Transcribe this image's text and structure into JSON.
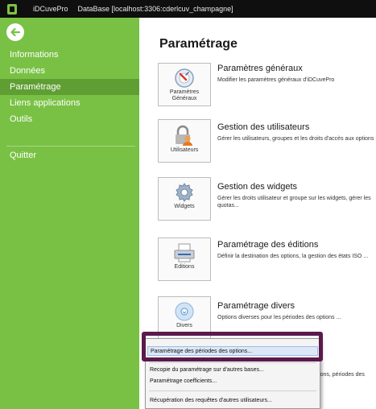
{
  "titlebar": {
    "app_name": "iDCuvePro",
    "db_info": "DataBase [localhost:3306:cderlcuv_champagne]"
  },
  "sidebar": {
    "items": [
      {
        "label": "Informations",
        "active": false
      },
      {
        "label": "Données",
        "active": false
      },
      {
        "label": "Paramétrage",
        "active": true
      },
      {
        "label": "Liens applications",
        "active": false
      },
      {
        "label": "Outils",
        "active": false
      }
    ],
    "quit_label": "Quitter"
  },
  "main": {
    "title": "Paramétrage",
    "sections": [
      {
        "tile_label": "Paramètres Généraux",
        "title": "Paramètres généraux",
        "desc": "Modifier les paramètres généraux d'iDCuvePro",
        "icon": "settings-gauge-icon"
      },
      {
        "tile_label": "Utilisateurs",
        "title": "Gestion des utilisateurs",
        "desc": "Gérer les utilisateurs, groupes et les droits d'accès aux options",
        "icon": "users-lock-icon"
      },
      {
        "tile_label": "Widgets",
        "title": "Gestion des widgets",
        "desc": "Gérer les droits utilisateur et groupe sur les widgets, gérer les quotas...",
        "icon": "widget-gear-icon"
      },
      {
        "tile_label": "Editions",
        "title": "Paramétrage des éditions",
        "desc": "Définir la destination des options, la gestion des états ISO ...",
        "icon": "printer-icon"
      },
      {
        "tile_label": "Divers",
        "title": "Paramétrage divers",
        "desc": "Options diverses pour les périodes des options ...",
        "icon": "misc-gear-icon"
      }
    ],
    "overflow_text": "érations, périodes des"
  },
  "context_menu": {
    "items": [
      "Paramétrage des périodes des options...",
      "Recopie du paramétrage sur d'autres bases...",
      "Paramétrage coefficients...",
      "Récupération des requêtes d'autres utilisateurs..."
    ]
  },
  "colors": {
    "sidebar": "#79c144",
    "sidebar_active": "#5f9e33",
    "titlebar": "#0f0f0f",
    "highlight_ring": "#5b1a4c"
  }
}
